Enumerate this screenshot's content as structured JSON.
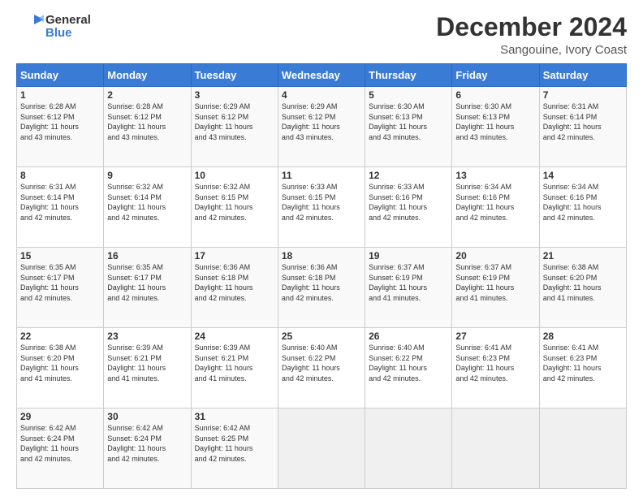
{
  "header": {
    "logo_line1": "General",
    "logo_line2": "Blue",
    "title": "December 2024",
    "subtitle": "Sangouine, Ivory Coast"
  },
  "weekdays": [
    "Sunday",
    "Monday",
    "Tuesday",
    "Wednesday",
    "Thursday",
    "Friday",
    "Saturday"
  ],
  "weeks": [
    [
      {
        "day": "1",
        "info": "Sunrise: 6:28 AM\nSunset: 6:12 PM\nDaylight: 11 hours\nand 43 minutes."
      },
      {
        "day": "2",
        "info": "Sunrise: 6:28 AM\nSunset: 6:12 PM\nDaylight: 11 hours\nand 43 minutes."
      },
      {
        "day": "3",
        "info": "Sunrise: 6:29 AM\nSunset: 6:12 PM\nDaylight: 11 hours\nand 43 minutes."
      },
      {
        "day": "4",
        "info": "Sunrise: 6:29 AM\nSunset: 6:12 PM\nDaylight: 11 hours\nand 43 minutes."
      },
      {
        "day": "5",
        "info": "Sunrise: 6:30 AM\nSunset: 6:13 PM\nDaylight: 11 hours\nand 43 minutes."
      },
      {
        "day": "6",
        "info": "Sunrise: 6:30 AM\nSunset: 6:13 PM\nDaylight: 11 hours\nand 43 minutes."
      },
      {
        "day": "7",
        "info": "Sunrise: 6:31 AM\nSunset: 6:14 PM\nDaylight: 11 hours\nand 42 minutes."
      }
    ],
    [
      {
        "day": "8",
        "info": "Sunrise: 6:31 AM\nSunset: 6:14 PM\nDaylight: 11 hours\nand 42 minutes."
      },
      {
        "day": "9",
        "info": "Sunrise: 6:32 AM\nSunset: 6:14 PM\nDaylight: 11 hours\nand 42 minutes."
      },
      {
        "day": "10",
        "info": "Sunrise: 6:32 AM\nSunset: 6:15 PM\nDaylight: 11 hours\nand 42 minutes."
      },
      {
        "day": "11",
        "info": "Sunrise: 6:33 AM\nSunset: 6:15 PM\nDaylight: 11 hours\nand 42 minutes."
      },
      {
        "day": "12",
        "info": "Sunrise: 6:33 AM\nSunset: 6:16 PM\nDaylight: 11 hours\nand 42 minutes."
      },
      {
        "day": "13",
        "info": "Sunrise: 6:34 AM\nSunset: 6:16 PM\nDaylight: 11 hours\nand 42 minutes."
      },
      {
        "day": "14",
        "info": "Sunrise: 6:34 AM\nSunset: 6:16 PM\nDaylight: 11 hours\nand 42 minutes."
      }
    ],
    [
      {
        "day": "15",
        "info": "Sunrise: 6:35 AM\nSunset: 6:17 PM\nDaylight: 11 hours\nand 42 minutes."
      },
      {
        "day": "16",
        "info": "Sunrise: 6:35 AM\nSunset: 6:17 PM\nDaylight: 11 hours\nand 42 minutes."
      },
      {
        "day": "17",
        "info": "Sunrise: 6:36 AM\nSunset: 6:18 PM\nDaylight: 11 hours\nand 42 minutes."
      },
      {
        "day": "18",
        "info": "Sunrise: 6:36 AM\nSunset: 6:18 PM\nDaylight: 11 hours\nand 42 minutes."
      },
      {
        "day": "19",
        "info": "Sunrise: 6:37 AM\nSunset: 6:19 PM\nDaylight: 11 hours\nand 41 minutes."
      },
      {
        "day": "20",
        "info": "Sunrise: 6:37 AM\nSunset: 6:19 PM\nDaylight: 11 hours\nand 41 minutes."
      },
      {
        "day": "21",
        "info": "Sunrise: 6:38 AM\nSunset: 6:20 PM\nDaylight: 11 hours\nand 41 minutes."
      }
    ],
    [
      {
        "day": "22",
        "info": "Sunrise: 6:38 AM\nSunset: 6:20 PM\nDaylight: 11 hours\nand 41 minutes."
      },
      {
        "day": "23",
        "info": "Sunrise: 6:39 AM\nSunset: 6:21 PM\nDaylight: 11 hours\nand 41 minutes."
      },
      {
        "day": "24",
        "info": "Sunrise: 6:39 AM\nSunset: 6:21 PM\nDaylight: 11 hours\nand 41 minutes."
      },
      {
        "day": "25",
        "info": "Sunrise: 6:40 AM\nSunset: 6:22 PM\nDaylight: 11 hours\nand 42 minutes."
      },
      {
        "day": "26",
        "info": "Sunrise: 6:40 AM\nSunset: 6:22 PM\nDaylight: 11 hours\nand 42 minutes."
      },
      {
        "day": "27",
        "info": "Sunrise: 6:41 AM\nSunset: 6:23 PM\nDaylight: 11 hours\nand 42 minutes."
      },
      {
        "day": "28",
        "info": "Sunrise: 6:41 AM\nSunset: 6:23 PM\nDaylight: 11 hours\nand 42 minutes."
      }
    ],
    [
      {
        "day": "29",
        "info": "Sunrise: 6:42 AM\nSunset: 6:24 PM\nDaylight: 11 hours\nand 42 minutes."
      },
      {
        "day": "30",
        "info": "Sunrise: 6:42 AM\nSunset: 6:24 PM\nDaylight: 11 hours\nand 42 minutes."
      },
      {
        "day": "31",
        "info": "Sunrise: 6:42 AM\nSunset: 6:25 PM\nDaylight: 11 hours\nand 42 minutes."
      },
      {
        "day": "",
        "info": ""
      },
      {
        "day": "",
        "info": ""
      },
      {
        "day": "",
        "info": ""
      },
      {
        "day": "",
        "info": ""
      }
    ]
  ]
}
